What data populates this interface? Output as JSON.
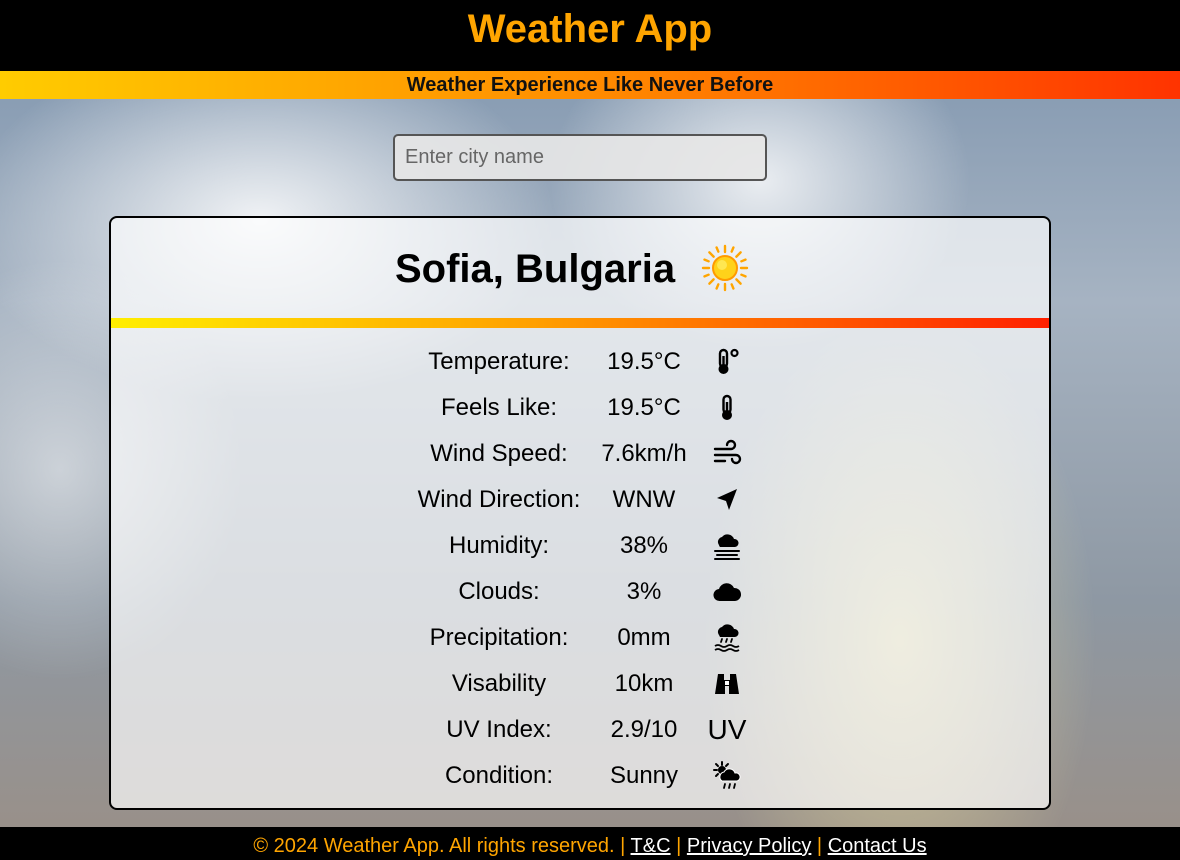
{
  "header": {
    "title": "Weather App",
    "tagline": "Weather Experience Like Never Before"
  },
  "search": {
    "placeholder": "Enter city name",
    "value": ""
  },
  "card": {
    "city": "Sofia, Bulgaria",
    "weather_icon": "sun-icon",
    "rows": [
      {
        "label": "Temperature:",
        "value": "19.5°C",
        "icon": "thermometer-degree-icon"
      },
      {
        "label": "Feels Like:",
        "value": "19.5°C",
        "icon": "thermometer-icon"
      },
      {
        "label": "Wind Speed:",
        "value": "7.6km/h",
        "icon": "wind-icon"
      },
      {
        "label": "Wind Direction:",
        "value": "WNW",
        "icon": "direction-arrow-icon"
      },
      {
        "label": "Humidity:",
        "value": "38%",
        "icon": "humidity-icon"
      },
      {
        "label": "Clouds:",
        "value": "3%",
        "icon": "cloud-icon"
      },
      {
        "label": "Precipitation:",
        "value": "0mm",
        "icon": "rain-icon"
      },
      {
        "label": "Visability",
        "value": "10km",
        "icon": "binoculars-icon"
      },
      {
        "label": "UV Index:",
        "value": "2.9/10",
        "icon": "uv-icon",
        "icon_text": "UV"
      },
      {
        "label": "Condition:",
        "value": "Sunny",
        "icon": "sun-cloud-rain-icon"
      }
    ]
  },
  "footer": {
    "copyright": "© 2024 Weather App. All rights reserved. |",
    "sep": "|",
    "links": [
      "T&C",
      "Privacy Policy",
      "Contact Us"
    ]
  },
  "colors": {
    "accent": "#ffa500",
    "header_bg": "#000000"
  }
}
